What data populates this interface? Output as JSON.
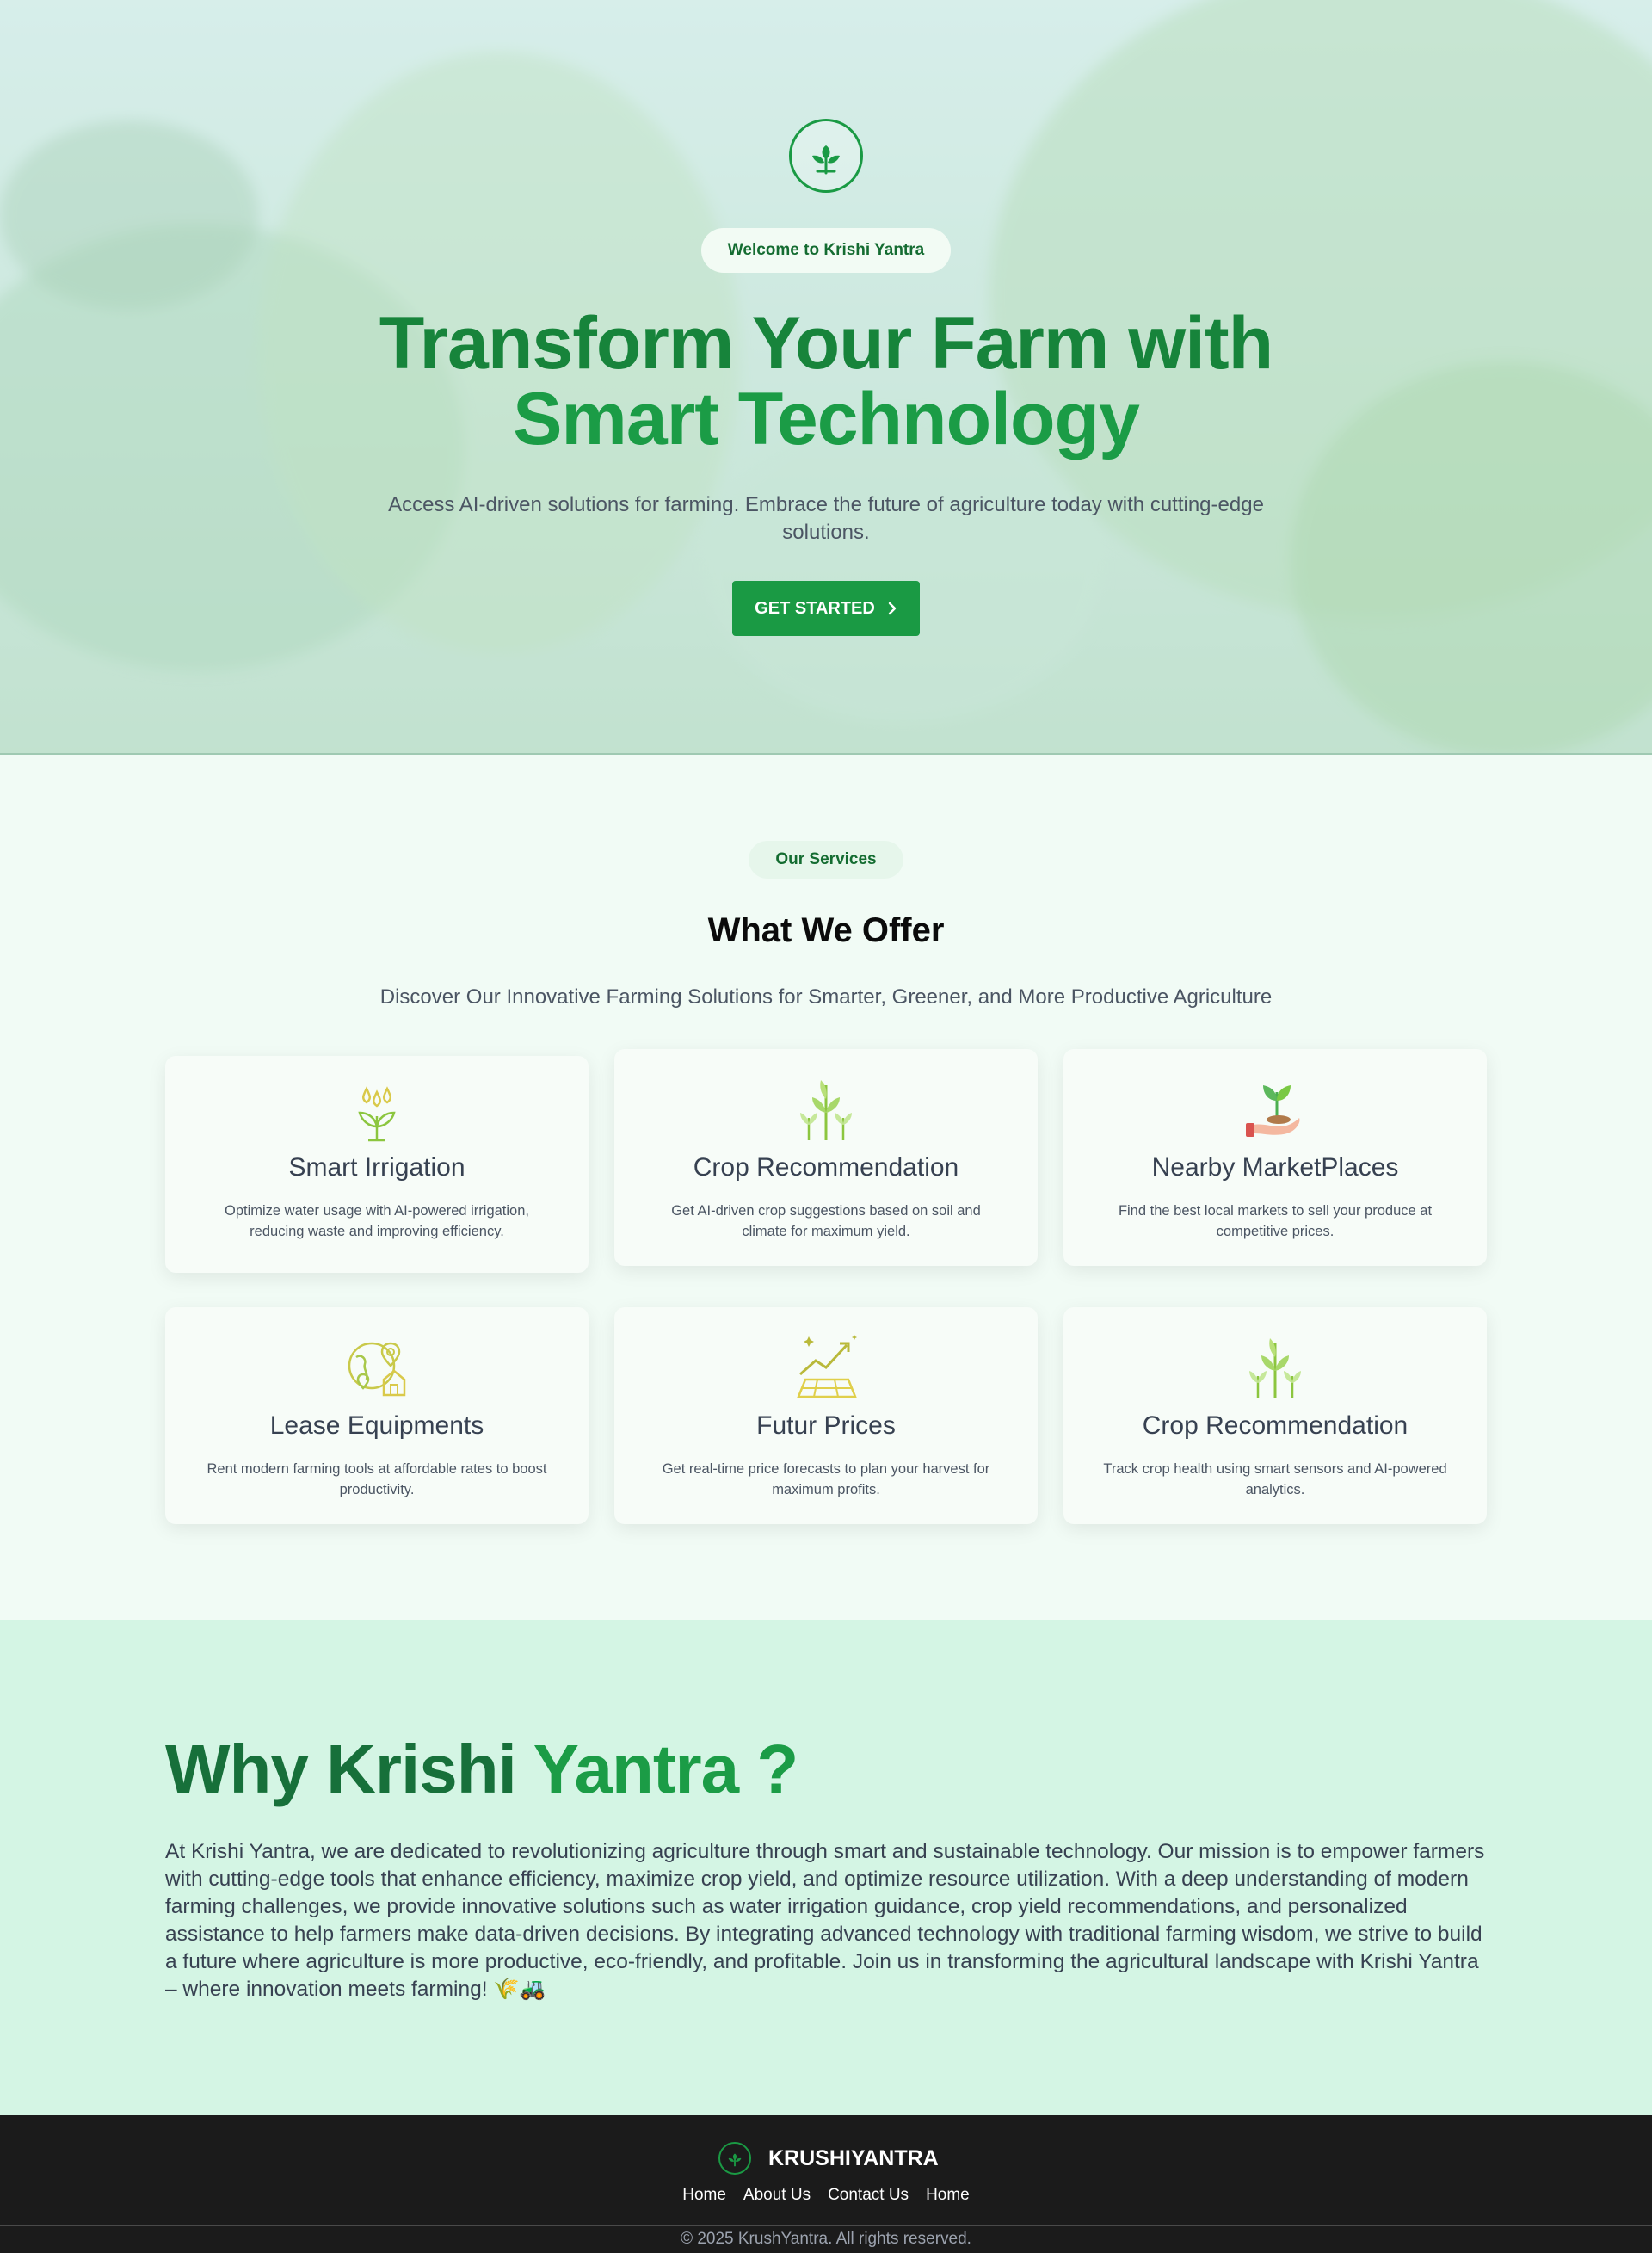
{
  "hero": {
    "welcome": "Welcome to Krishi Yantra",
    "title_line1": "Transform Your Farm with",
    "title_line2": "Smart Technology",
    "subtitle": "Access AI-driven solutions for farming. Embrace the future of agriculture today with cutting-edge solutions.",
    "cta_label": "GET STARTED",
    "logo_icon": "sprout-icon",
    "cta_icon": "chevron-right-icon"
  },
  "services": {
    "pill": "Our Services",
    "title": "What We Offer",
    "subtitle": "Discover Our Innovative Farming Solutions for Smarter, Greener, and More Productive Agriculture",
    "cards": [
      {
        "title": "Smart Irrigation",
        "desc": "Optimize water usage with AI-powered irrigation, reducing waste and improving efficiency.",
        "icon": "irrigation-drops-plant-icon"
      },
      {
        "title": "Crop Recommendation",
        "desc": "Get AI-driven crop suggestions based on soil and climate for maximum yield.",
        "icon": "crop-plants-icon"
      },
      {
        "title": "Nearby MarketPlaces",
        "desc": "Find the best local markets to sell your produce at competitive prices.",
        "icon": "hand-sprout-icon"
      },
      {
        "title": "Lease Equipments",
        "desc": "Rent modern farming tools at affordable rates to boost productivity.",
        "icon": "globe-location-house-icon"
      },
      {
        "title": "Futur Prices",
        "desc": "Get real-time price forecasts to plan your harvest for maximum profits.",
        "icon": "growth-chart-field-icon"
      },
      {
        "title": "Crop Recommendation",
        "desc": "Track crop health using smart sensors and AI-powered analytics.",
        "icon": "crop-plants-icon"
      }
    ]
  },
  "why": {
    "title_part1": "Why Krishi",
    "title_part2": "Yantra ?",
    "body": "At Krishi Yantra, we are dedicated to revolutionizing agriculture through smart and sustainable technology. Our mission is to empower farmers with cutting-edge tools that enhance efficiency, maximize crop yield, and optimize resource utilization. With a deep understanding of modern farming challenges, we provide innovative solutions such as water irrigation guidance, crop yield recommendations, and personalized assistance to help farmers make data-driven decisions. By integrating advanced technology with traditional farming wisdom, we strive to build a future where agriculture is more productive, eco-friendly, and profitable. Join us in transforming the agricultural landscape with Krishi Yantra – where innovation meets farming! 🌾🚜"
  },
  "footer": {
    "brand": "KRUSHIYANTRA",
    "nav": [
      "Home",
      "About Us",
      "Contact Us",
      "Home"
    ],
    "copyright": "© 2025 KrushYantra. All rights reserved."
  },
  "colors": {
    "brand_green": "#1a9a44",
    "dark_green": "#17703a",
    "services_bg": "#f1fbf5",
    "why_bg": "#d4f5e4",
    "footer_bg": "#1b1b1b"
  }
}
